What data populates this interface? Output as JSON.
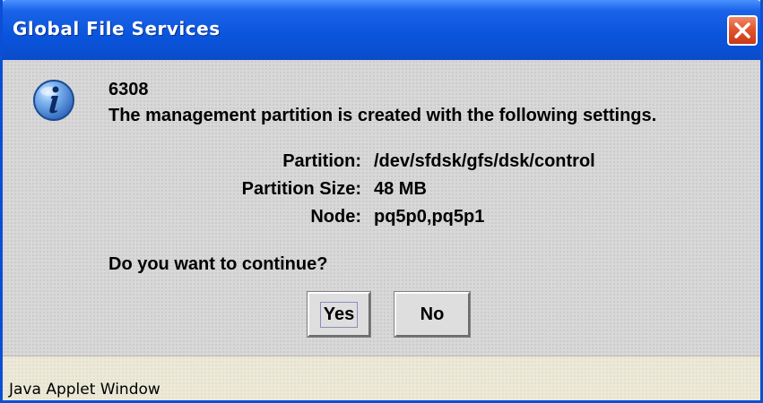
{
  "window": {
    "title": "Global File Services"
  },
  "message": {
    "code": "6308",
    "text": "The management partition is created with the following settings.",
    "settings": [
      {
        "label": "Partition:",
        "value": "/dev/sfdsk/gfs/dsk/control"
      },
      {
        "label": "Partition Size:",
        "value": "48 MB"
      },
      {
        "label": "Node:",
        "value": "pq5p0,pq5p1"
      }
    ],
    "question": "Do you want to continue?"
  },
  "buttons": {
    "yes_label": "Yes",
    "no_label": "No"
  },
  "status": {
    "text": "Java Applet Window"
  },
  "icons": {
    "message": "info-icon",
    "close": "close-icon"
  },
  "colors": {
    "titlebar": "#0a54dc",
    "close_button": "#e2552f",
    "dialog_background": "#d8d8d8",
    "statusbar_background": "#ece9d8"
  }
}
